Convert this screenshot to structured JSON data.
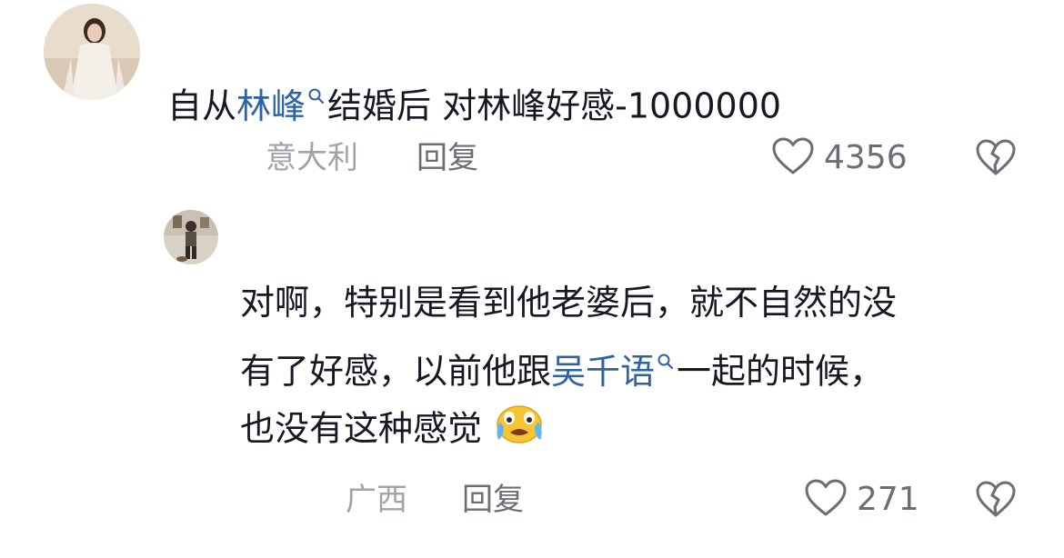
{
  "comments": [
    {
      "text_parts": [
        {
          "text": "自从",
          "link": false
        },
        {
          "text": "林峰",
          "link": true
        },
        {
          "text": "结婚后 对林峰好感-1000000",
          "link": false
        }
      ],
      "location": "意大利",
      "reply_label": "回复",
      "likes": "4356",
      "icons": {
        "like": "heart-outline-icon",
        "dislike": "broken-heart-icon",
        "search": "search-icon"
      }
    },
    {
      "lines": [
        [
          {
            "text": "对啊，特别是看到他老婆后，就不自然的没",
            "link": false
          }
        ],
        [
          {
            "text": "有了好感，以前他跟",
            "link": false
          },
          {
            "text": "吴千语",
            "link": true
          },
          {
            "text": "一起的时候，",
            "link": false
          }
        ],
        [
          {
            "text": "也没有这种感觉",
            "link": false
          }
        ]
      ],
      "emoji": "crying-face-emoji",
      "location": "广西",
      "reply_label": "回复",
      "likes": "271",
      "icons": {
        "like": "heart-outline-icon",
        "dislike": "broken-heart-icon",
        "search": "search-icon"
      }
    }
  ],
  "colors": {
    "link": "#2e63a6",
    "text": "#161823",
    "meta": "#a0a3a8",
    "action": "#6b6e75"
  }
}
